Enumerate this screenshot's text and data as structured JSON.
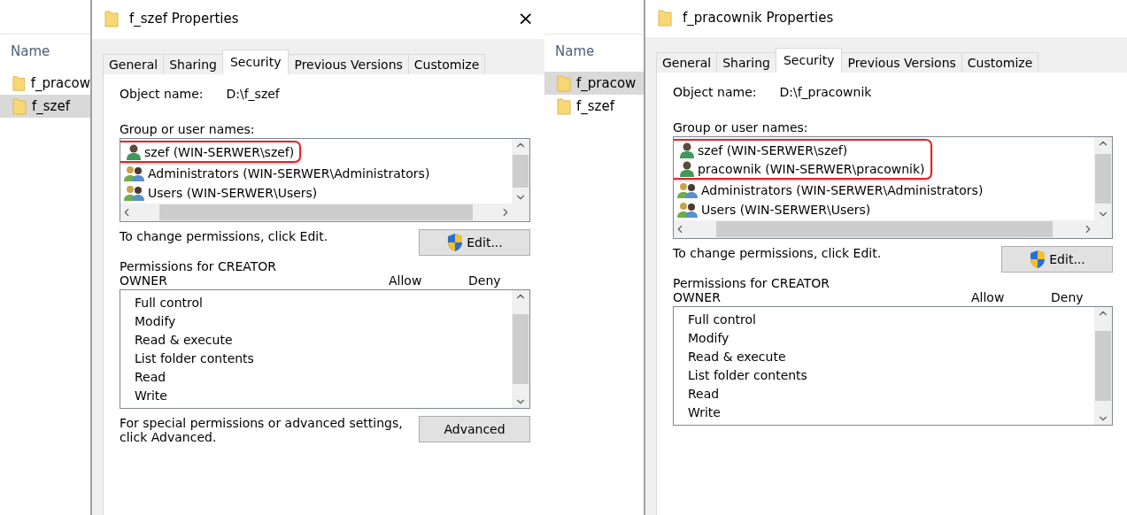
{
  "panels": [
    {
      "explorer": {
        "header": "Name",
        "files": [
          {
            "name": "f_pracow",
            "selected": false
          },
          {
            "name": "f_szef",
            "selected": true
          }
        ]
      },
      "dialog": {
        "title": "f_szef Properties",
        "close": "×",
        "tabs": [
          {
            "label": "General",
            "selected": false
          },
          {
            "label": "Sharing",
            "selected": false
          },
          {
            "label": "Security",
            "selected": true
          },
          {
            "label": "Previous Versions",
            "selected": false
          },
          {
            "label": "Customize",
            "selected": false
          }
        ],
        "object_label": "Object name:",
        "object_value": "D:\\f_szef",
        "group_label": "Group or user names:",
        "users": [
          {
            "name": "szef (WIN-SERWER\\szef)",
            "kind": "user",
            "highlighted": true
          },
          {
            "name": "Administrators (WIN-SERWER\\Administrators)",
            "kind": "group",
            "highlighted": false
          },
          {
            "name": "Users (WIN-SERWER\\Users)",
            "kind": "group",
            "highlighted": false
          }
        ],
        "change_text": "To change permissions, click Edit.",
        "edit_button": "Edit...",
        "perms_label": "Permissions for CREATOR OWNER",
        "allow": "Allow",
        "deny": "Deny",
        "permissions": [
          "Full control",
          "Modify",
          "Read & execute",
          "List folder contents",
          "Read",
          "Write"
        ],
        "advanced_text": "For special permissions or advanced settings, click Advanced.",
        "advanced_button": "Advanced"
      }
    },
    {
      "explorer": {
        "header": "Name",
        "files": [
          {
            "name": "f_pracow",
            "selected": true
          },
          {
            "name": "f_szef",
            "selected": false
          }
        ]
      },
      "dialog": {
        "title": "f_pracownik Properties",
        "tabs": [
          {
            "label": "General",
            "selected": false
          },
          {
            "label": "Sharing",
            "selected": false
          },
          {
            "label": "Security",
            "selected": true
          },
          {
            "label": "Previous Versions",
            "selected": false
          },
          {
            "label": "Customize",
            "selected": false
          }
        ],
        "object_label": "Object name:",
        "object_value": "D:\\f_pracownik",
        "group_label": "Group or user names:",
        "users": [
          {
            "name": "szef (WIN-SERWER\\szef)",
            "kind": "user",
            "highlighted": true
          },
          {
            "name": "pracownik (WIN-SERWER\\pracownik)",
            "kind": "user",
            "highlighted": true
          },
          {
            "name": "Administrators (WIN-SERWER\\Administrators)",
            "kind": "group",
            "highlighted": false
          },
          {
            "name": "Users (WIN-SERWER\\Users)",
            "kind": "group",
            "highlighted": false
          }
        ],
        "change_text": "To change permissions, click Edit.",
        "edit_button": "Edit...",
        "perms_label": "Permissions for CREATOR OWNER",
        "allow": "Allow",
        "deny": "Deny",
        "permissions": [
          "Full control",
          "Modify",
          "Read & execute",
          "List folder contents",
          "Read",
          "Write"
        ]
      }
    }
  ]
}
